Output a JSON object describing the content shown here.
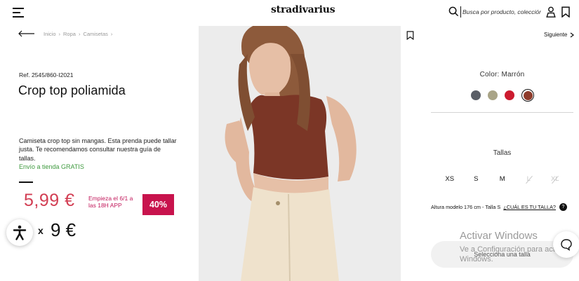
{
  "header": {
    "logo_text": "stradivarius",
    "search_placeholder": "Busca por producto, colección..."
  },
  "breadcrumb": [
    "Inicio",
    "Ropa",
    "Camisetas"
  ],
  "product": {
    "ref": "Ref. 2545/860-I2021",
    "title": "Crop top poliamida",
    "description": "Camiseta crop top sin mangas. Esta prenda puede tallar justa. Te recomendamos consultar nuestra guía de tallas.",
    "shipping": "Envío a tienda GRATIS",
    "price": "5,99 €",
    "promo": "Empieza el 6/1 a las 18H APP",
    "discount": "40%",
    "old_price": "9 €"
  },
  "overlay": {
    "close_label": "x"
  },
  "nav": {
    "next_label": "Siguiente"
  },
  "colors": {
    "label": "Color: Marrón",
    "swatches": [
      {
        "name": "gris oscuro",
        "hex": "#5a5e66"
      },
      {
        "name": "beige",
        "hex": "#a9a487"
      },
      {
        "name": "rojo",
        "hex": "#cc1b2f"
      },
      {
        "name": "marrón",
        "hex": "#8f3c2b",
        "selected": true
      }
    ]
  },
  "sizes": {
    "label": "Tallas",
    "items": [
      {
        "label": "XS",
        "available": true
      },
      {
        "label": "S",
        "available": true
      },
      {
        "label": "M",
        "available": true
      },
      {
        "label": "L",
        "available": false
      },
      {
        "label": "XL",
        "available": false
      }
    ],
    "model_info": "Altura modelo 176 cm - Talla S",
    "size_guide": "¿CUÁL ES TU TALLA?",
    "help_glyph": "?"
  },
  "cta": {
    "label": "Selecciona una talla"
  },
  "windows_watermark": {
    "title": "Activar Windows",
    "subtitle": "Ve a Configuración para activar Windows."
  },
  "theme": {
    "price_color": "#d23e53",
    "discount_bg": "#c8134d",
    "shipping_color": "#3f9a3f"
  }
}
